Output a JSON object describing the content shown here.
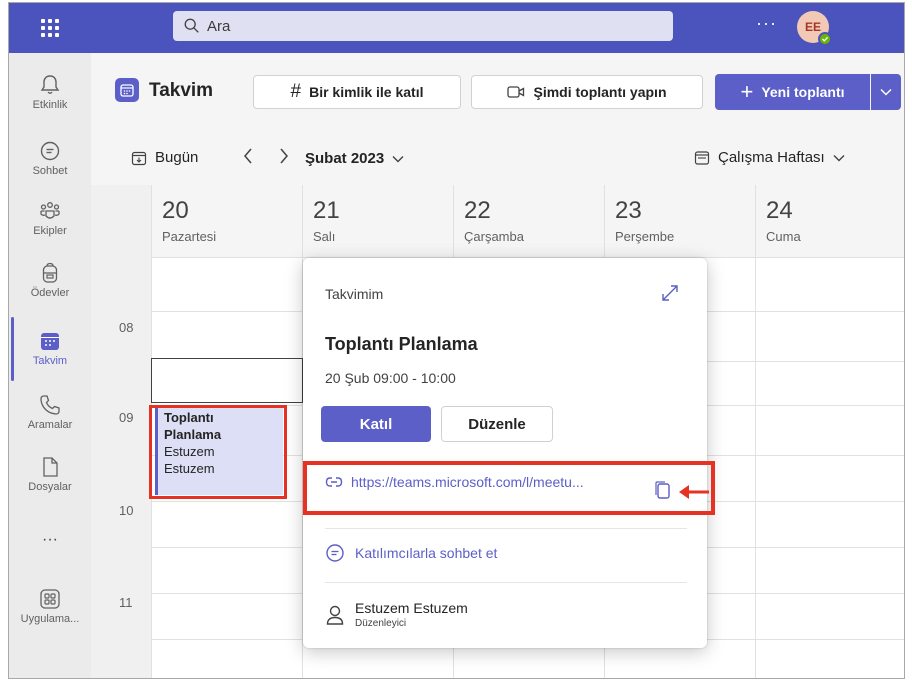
{
  "topbar": {
    "search_placeholder": "Ara",
    "more_label": "···",
    "avatar_initials": "EE"
  },
  "rail": {
    "items": [
      {
        "label": "Etkinlik",
        "icon": "bell-icon"
      },
      {
        "label": "Sohbet",
        "icon": "chat-icon"
      },
      {
        "label": "Ekipler",
        "icon": "teams-icon"
      },
      {
        "label": "Ödevler",
        "icon": "backpack-icon"
      },
      {
        "label": "Takvim",
        "icon": "calendar-icon",
        "active": true
      },
      {
        "label": "Aramalar",
        "icon": "phone-icon"
      },
      {
        "label": "Dosyalar",
        "icon": "file-icon"
      },
      {
        "label": "···",
        "icon": "more-icon"
      },
      {
        "label": "Uygulama...",
        "icon": "apps-icon"
      }
    ]
  },
  "header": {
    "title": "Takvim",
    "join_with_id": "Bir kimlik ile katıl",
    "meet_now": "Şimdi toplantı yapın",
    "new_meeting": "Yeni toplantı"
  },
  "nav": {
    "today": "Bugün",
    "month": "Şubat 2023",
    "view": "Çalışma Haftası"
  },
  "days": [
    {
      "num": "20",
      "name": "Pazartesi"
    },
    {
      "num": "21",
      "name": "Salı"
    },
    {
      "num": "22",
      "name": "Çarşamba"
    },
    {
      "num": "23",
      "name": "Perşembe"
    },
    {
      "num": "24",
      "name": "Cuma"
    }
  ],
  "hours": [
    "08",
    "09",
    "10",
    "11"
  ],
  "event": {
    "title_line1": "Toplantı",
    "title_line2": "Planlama",
    "org_line1": "Estuzem",
    "org_line2": "Estuzem"
  },
  "popup": {
    "calendar_name": "Takvimim",
    "title": "Toplantı Planlama",
    "time": "20 Şub 09:00 - 10:00",
    "join_label": "Katıl",
    "edit_label": "Düzenle",
    "link": "https://teams.microsoft.com/l/meetu...",
    "chat_label": "Katılımcılarla sohbet et",
    "organizer_name": "Estuzem Estuzem",
    "organizer_role": "Düzenleyici"
  },
  "colors": {
    "brand": "#5b5fc7",
    "topbar": "#4b53bc",
    "highlight": "#e53223",
    "event_bg": "#dcdff5"
  }
}
